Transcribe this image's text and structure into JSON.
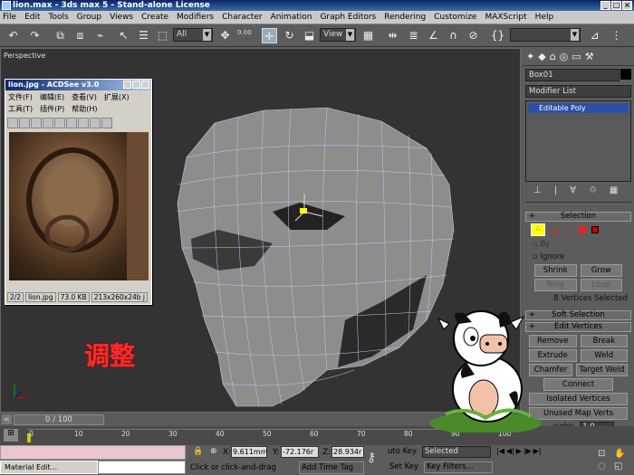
{
  "window": {
    "title": "lion.max - 3ds max 5 - Stand-alone License"
  },
  "menu": [
    "File",
    "Edit",
    "Tools",
    "Group",
    "Views",
    "Create",
    "Modifiers",
    "Character",
    "Animation",
    "Graph Editors",
    "Rendering",
    "Customize",
    "MAXScript",
    "Help"
  ],
  "toolbar": {
    "selection_filter": "All",
    "view_dropdown": "View",
    "spinner_value": "0.00"
  },
  "viewport": {
    "label": "Perspective"
  },
  "acdsee": {
    "title": "lion.jpg - ACDSee v3.0",
    "menu": [
      "文件(F)",
      "编辑(E)",
      "查看(V)",
      "扩展(X)",
      "工具(T)",
      "插件(P)",
      "帮助(H)"
    ],
    "status": {
      "index": "2/2",
      "file": "lion.jpg",
      "size": "73.0 KB",
      "dims": "213x260x24b j"
    }
  },
  "annotation": "调整",
  "command_panel": {
    "object_name": "Box01",
    "modifier_list": "Modifier List",
    "stack_item": "Editable Poly",
    "selection_header": "Selection",
    "by_label": "By",
    "ignore_label": "Ignore",
    "shrink": "Shrink",
    "grow": "Grow",
    "ring": "Ring",
    "loop": "Loop",
    "selected_count": "8 Vertices Selected",
    "soft_selection": "Soft Selection",
    "edit_vertices": "Edit Vertices",
    "remove": "Remove",
    "break": "Break",
    "extrude": "Extrude",
    "weld": "Weld",
    "chamfer": "Chamfer",
    "target_weld": "Target Weld",
    "connect": "Connect",
    "isolated": "Isolated Vertices",
    "unused_map": "Unused Map Verts",
    "weight_label": "eight:",
    "weight_value": "1.0"
  },
  "timeline": {
    "frame": "0 / 100",
    "ticks": [
      "0",
      "10",
      "20",
      "30",
      "40",
      "50",
      "60",
      "70",
      "80",
      "90",
      "100"
    ]
  },
  "status": {
    "x_value": "9.611mm",
    "y_value": "-72.176r",
    "z_value": "28.934r",
    "prompt": "Click or click-and-drag",
    "add_time_tag": "Add Time Tag",
    "auto_key": "uto Key",
    "selected": "Selected",
    "set_key": "Set Key",
    "key_filters": "Key Filters...",
    "taskbar_item": "Material Edit..."
  }
}
